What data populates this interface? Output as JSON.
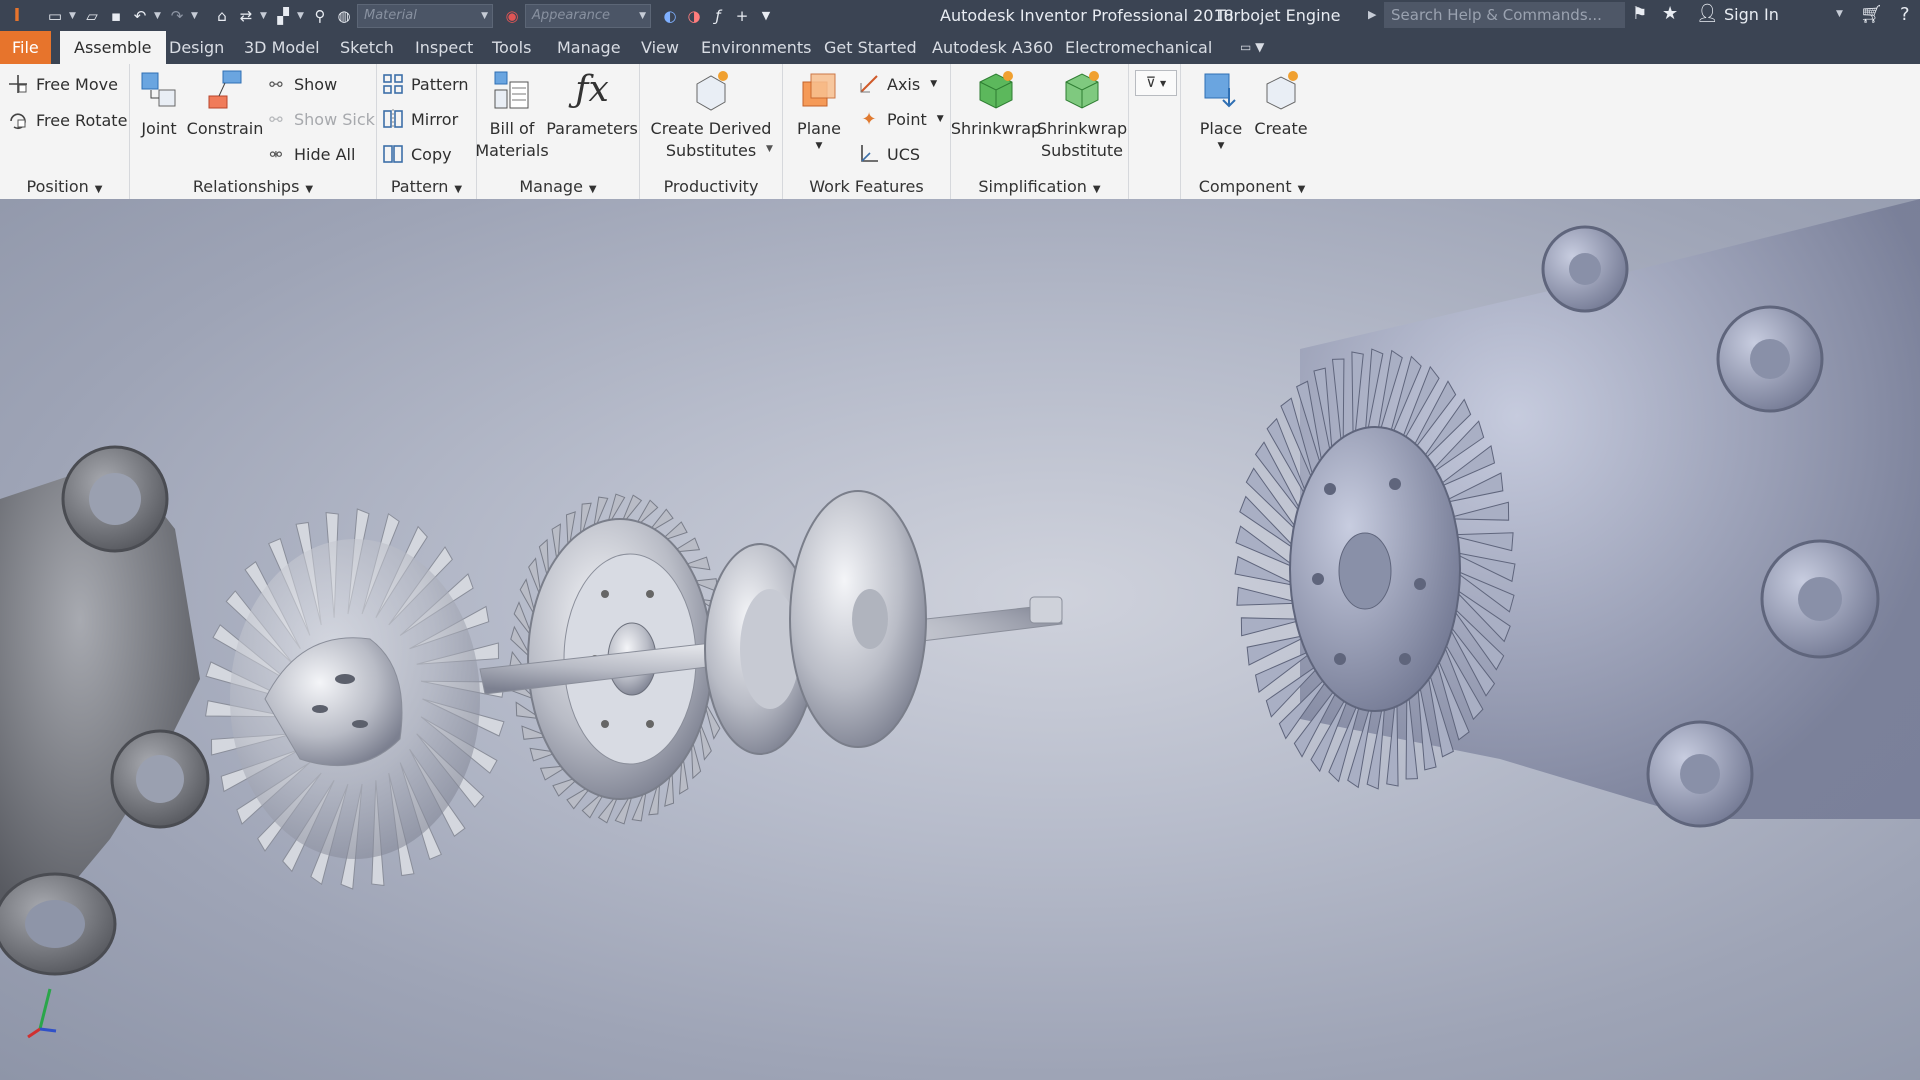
{
  "title_bar": {
    "app_title": "Autodesk Inventor Professional 2018",
    "document_title": "Turbojet Engine",
    "material_placeholder": "Material",
    "appearance_placeholder": "Appearance",
    "search_placeholder": "Search Help & Commands...",
    "sign_in": "Sign In"
  },
  "tabs": [
    "File",
    "Assemble",
    "Design",
    "3D Model",
    "Sketch",
    "Inspect",
    "Tools",
    "Manage",
    "View",
    "Environments",
    "Get Started",
    "Autodesk A360",
    "Electromechanical"
  ],
  "active_tab": "Assemble",
  "ribbon": {
    "position": {
      "label": "Position",
      "free_move": "Free Move",
      "free_rotate": "Free Rotate"
    },
    "relationships": {
      "label": "Relationships",
      "joint": "Joint",
      "constrain": "Constrain",
      "show": "Show",
      "show_sick": "Show Sick",
      "hide_all": "Hide All"
    },
    "pattern": {
      "label": "Pattern",
      "pattern": "Pattern",
      "mirror": "Mirror",
      "copy": "Copy"
    },
    "manage": {
      "label": "Manage",
      "bom_line1": "Bill of",
      "bom_line2": "Materials",
      "parameters": "Parameters"
    },
    "productivity": {
      "label": "Productivity",
      "cds_line1": "Create Derived",
      "cds_line2": "Substitutes"
    },
    "work_features": {
      "label": "Work Features",
      "plane": "Plane",
      "axis": "Axis",
      "point": "Point",
      "ucs": "UCS"
    },
    "simplification": {
      "label": "Simplification",
      "shrinkwrap": "Shrinkwrap",
      "sws_line1": "Shrinkwrap",
      "sws_line2": "Substitute"
    },
    "component": {
      "label": "Component",
      "place": "Place",
      "create": "Create"
    }
  },
  "colors": {
    "file_tab": "#e7742c",
    "title_bar": "#3b4453",
    "ribbon_bg": "#f4f4f4"
  }
}
